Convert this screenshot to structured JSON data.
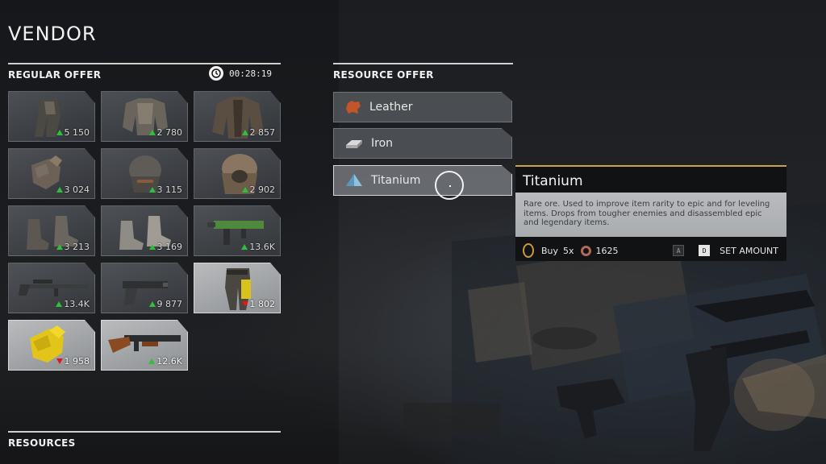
{
  "header": {
    "title": "VENDOR"
  },
  "regular_offer": {
    "label": "REGULAR OFFER",
    "timer": "00:28:19",
    "items": [
      {
        "name": "legs-armor",
        "price": "5 150",
        "trend": "up"
      },
      {
        "name": "chest-armor",
        "price": "2 780",
        "trend": "up"
      },
      {
        "name": "coat",
        "price": "2 857",
        "trend": "up"
      },
      {
        "name": "glove",
        "price": "3 024",
        "trend": "up"
      },
      {
        "name": "helmet",
        "price": "3 115",
        "trend": "up"
      },
      {
        "name": "hood",
        "price": "2 902",
        "trend": "up"
      },
      {
        "name": "boots",
        "price": "3 213",
        "trend": "up"
      },
      {
        "name": "boots-light",
        "price": "3 169",
        "trend": "up"
      },
      {
        "name": "green-smg",
        "price": "13.6K",
        "trend": "up"
      },
      {
        "name": "sniper-rifle",
        "price": "13.4K",
        "trend": "up"
      },
      {
        "name": "pistol",
        "price": "9 877",
        "trend": "up"
      },
      {
        "name": "yellow-pants",
        "price": "1 802",
        "trend": "down"
      },
      {
        "name": "yellow-glove",
        "price": "1 958",
        "trend": "down"
      },
      {
        "name": "shotgun",
        "price": "12.6K",
        "trend": "up"
      }
    ]
  },
  "resources_section": {
    "label": "RESOURCES"
  },
  "resource_offer": {
    "label": "RESOURCE OFFER",
    "items": [
      {
        "label": "Leather",
        "icon": "leather-icon",
        "color": "#c2552a"
      },
      {
        "label": "Iron",
        "icon": "iron-ingot-icon",
        "color": "#c8c8c8"
      },
      {
        "label": "Titanium",
        "icon": "titanium-crystal-icon",
        "color": "#8fc0e0"
      }
    ]
  },
  "tooltip": {
    "title": "Titanium",
    "description": "Rare ore. Used to improve item rarity to epic and for leveling items. Drops from tougher enemies and disassembled epic and legendary items.",
    "buy_label": "Buy",
    "quantity": "5x",
    "cost": "1625",
    "key_prev": "A",
    "key_next": "D",
    "set_amount_label": "SET AMOUNT",
    "accent_color": "#c9a24a"
  }
}
